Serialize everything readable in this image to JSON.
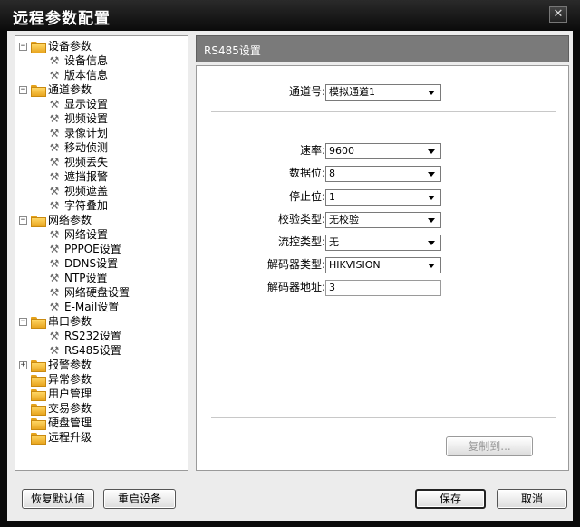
{
  "window": {
    "title": "远程参数配置",
    "close_glyph": "✕"
  },
  "tree": {
    "groups": [
      {
        "label": "设备参数",
        "expander": "−",
        "children": [
          "设备信息",
          "版本信息"
        ]
      },
      {
        "label": "通道参数",
        "expander": "−",
        "children": [
          "显示设置",
          "视频设置",
          "录像计划",
          "移动侦测",
          "视频丢失",
          "遮挡报警",
          "视频遮盖",
          "字符叠加"
        ]
      },
      {
        "label": "网络参数",
        "expander": "−",
        "children": [
          "网络设置",
          "PPPOE设置",
          "DDNS设置",
          "NTP设置",
          "网络硬盘设置",
          "E-Mail设置"
        ]
      },
      {
        "label": "串口参数",
        "expander": "−",
        "children": [
          "RS232设置",
          "RS485设置"
        ]
      },
      {
        "label": "报警参数",
        "expander": "+",
        "children": []
      },
      {
        "label": "异常参数",
        "expander": "",
        "children": []
      },
      {
        "label": "用户管理",
        "expander": "",
        "children": []
      },
      {
        "label": "交易参数",
        "expander": "",
        "children": []
      },
      {
        "label": "硬盘管理",
        "expander": "",
        "children": []
      },
      {
        "label": "远程升级",
        "expander": "",
        "children": []
      }
    ],
    "selected": "RS485设置"
  },
  "panel": {
    "header": "RS485设置",
    "channel": {
      "label": "通道号:",
      "value": "模拟通道1"
    },
    "baud": {
      "label": "速率:",
      "value": "9600"
    },
    "data_bits": {
      "label": "数据位:",
      "value": "8"
    },
    "stop_bits": {
      "label": "停止位:",
      "value": "1"
    },
    "parity": {
      "label": "校验类型:",
      "value": "无校验"
    },
    "flow": {
      "label": "流控类型:",
      "value": "无"
    },
    "decoder_type": {
      "label": "解码器类型:",
      "value": "HIKVISION"
    },
    "decoder_addr": {
      "label": "解码器地址:",
      "value": "3"
    },
    "copy_button": "复制到..."
  },
  "footer": {
    "restore_defaults": "恢复默认值",
    "reboot": "重启设备",
    "save": "保存",
    "cancel": "取消"
  },
  "colors": {
    "titlebar": "#0b0b0b",
    "panel_header": "#7a7a7a",
    "folder": "#f2b733"
  },
  "icons": {
    "folder": "folder-icon",
    "leaf": "wrench-icon",
    "dropdown": "chevron-down-icon"
  }
}
